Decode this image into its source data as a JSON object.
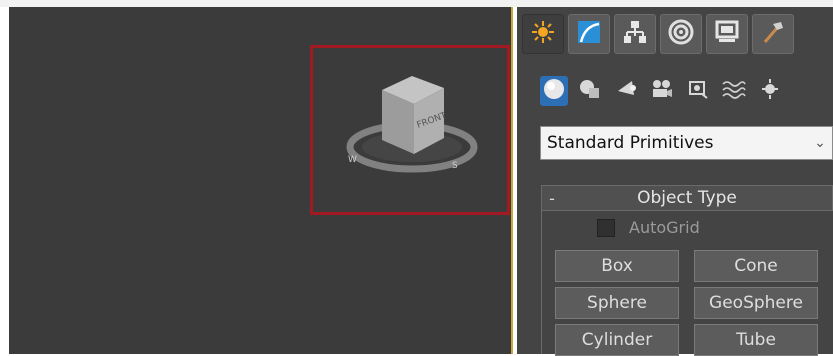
{
  "command_panel": {
    "tabs": [
      {
        "icon": "create-icon",
        "active": true
      },
      {
        "icon": "modify-icon",
        "active": false
      },
      {
        "icon": "hierarchy-icon",
        "active": false
      },
      {
        "icon": "motion-icon",
        "active": false
      },
      {
        "icon": "display-icon",
        "active": false
      },
      {
        "icon": "utilities-icon",
        "active": false
      }
    ],
    "sub_categories": [
      {
        "icon": "geometry-icon",
        "active": true
      },
      {
        "icon": "shapes-icon",
        "active": false
      },
      {
        "icon": "lights-icon",
        "active": false
      },
      {
        "icon": "cameras-icon",
        "active": false
      },
      {
        "icon": "helpers-icon",
        "active": false
      },
      {
        "icon": "space-warps-icon",
        "active": false
      },
      {
        "icon": "systems-icon",
        "active": false
      }
    ],
    "category_dropdown": {
      "selected": "Standard Primitives"
    },
    "object_type": {
      "collapse_symbol": "-",
      "title": "Object Type",
      "autogrid_label": "AutoGrid",
      "buttons": [
        "Box",
        "Cone",
        "Sphere",
        "GeoSphere",
        "Cylinder",
        "Tube"
      ]
    }
  },
  "viewport": {
    "viewcube": {
      "face_label": "FRONT",
      "compass_letters": [
        "W",
        "S"
      ]
    },
    "highlight_color": "#a11a22"
  },
  "colors": {
    "viewport_bg": "#3b3b3b",
    "panel_bg": "#444444",
    "active_blue": "#2c6fb4",
    "active_border": "#c9a73a"
  }
}
